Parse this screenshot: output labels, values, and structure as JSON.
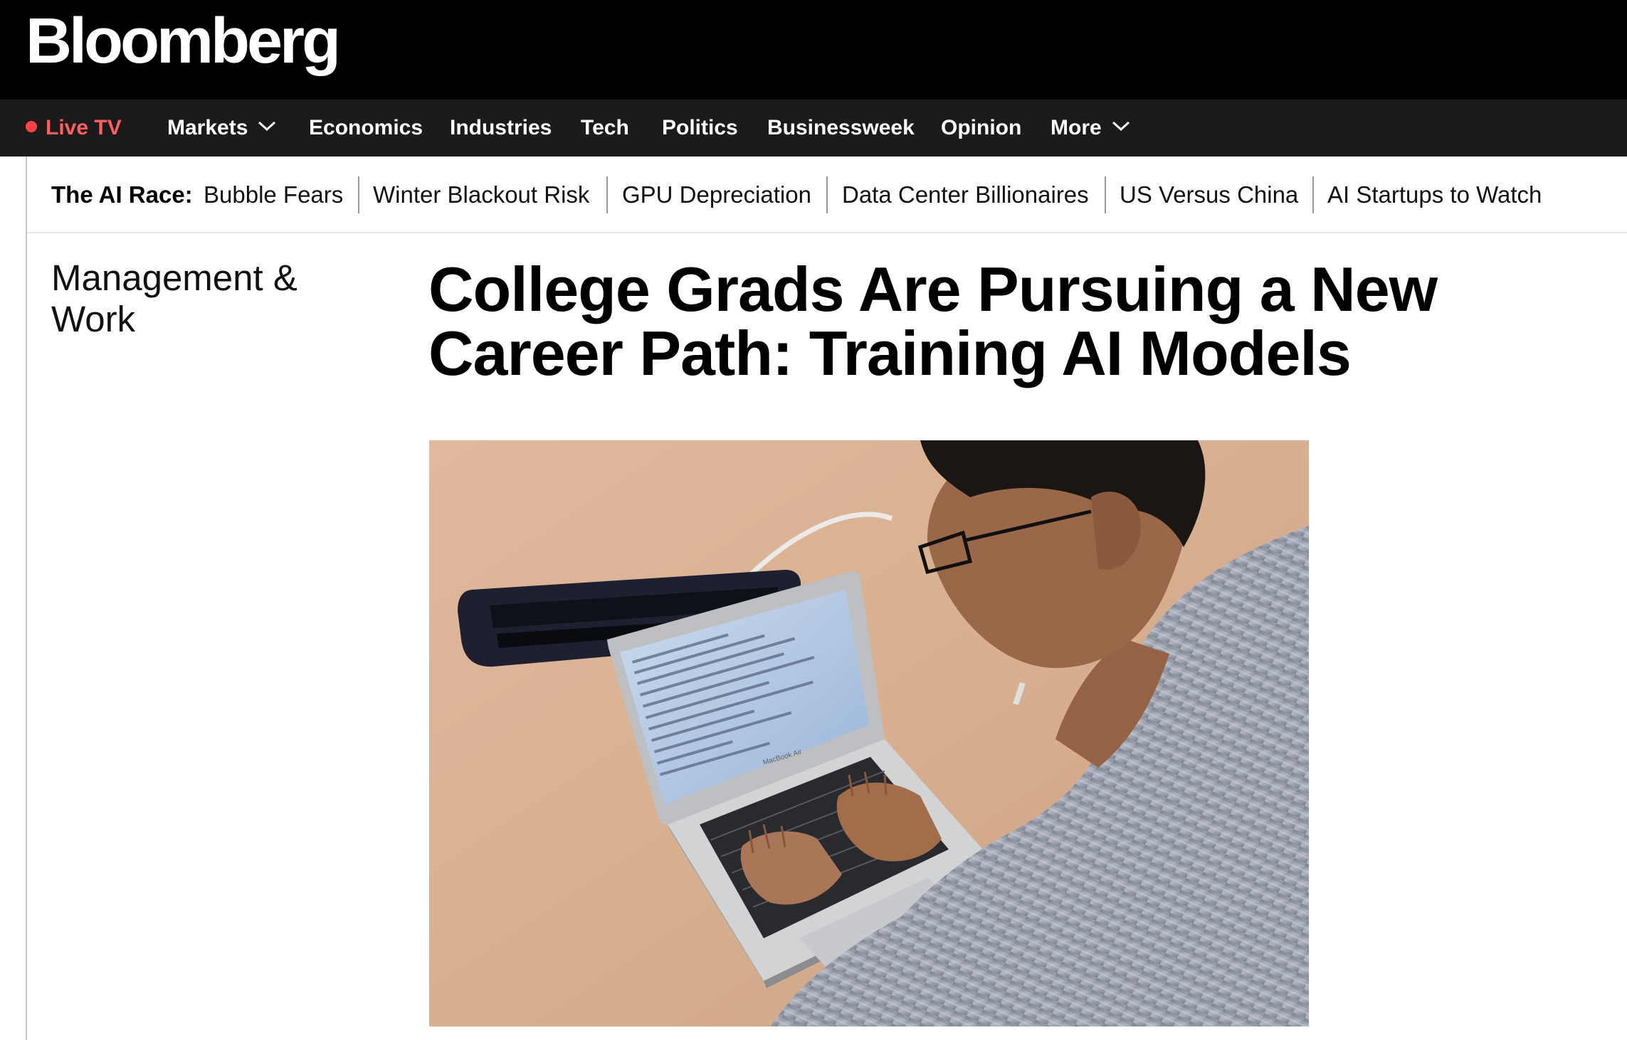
{
  "header": {
    "logo_text": "Bloomberg"
  },
  "nav": {
    "live_tv": "Live TV",
    "items": [
      "Markets",
      "Economics",
      "Industries",
      "Tech",
      "Politics",
      "Businessweek",
      "Opinion",
      "More"
    ]
  },
  "race_bar": {
    "label": "The AI Race:",
    "links": [
      "Bubble Fears",
      "Winter Blackout Risk",
      "GPU Depreciation",
      "Data Center Billionaires",
      "US Versus China",
      "AI Startups to Watch"
    ]
  },
  "article": {
    "section": "Management & Work",
    "headline": "College Grads Are Pursuing a New Career Path: Training AI Models",
    "laptop_brand": "MacBook Air"
  },
  "colors": {
    "brand_bar": "#000000",
    "nav_bar": "#1b1b1b",
    "live_accent": "#ff5f5f",
    "text": "#000000"
  },
  "icons": {
    "live": "red-dot-icon",
    "dropdown": "chevron-down-icon"
  }
}
